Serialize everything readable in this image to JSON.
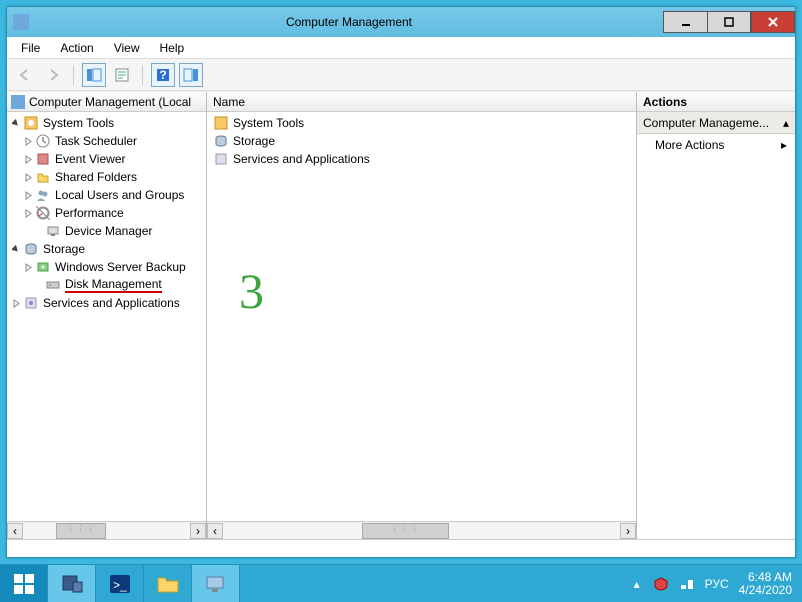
{
  "window": {
    "title": "Computer Management"
  },
  "menubar": [
    "File",
    "Action",
    "View",
    "Help"
  ],
  "tree": {
    "root": "Computer Management (Local",
    "system_tools": {
      "label": "System Tools",
      "children": [
        "Task Scheduler",
        "Event Viewer",
        "Shared Folders",
        "Local Users and Groups",
        "Performance",
        "Device Manager"
      ]
    },
    "storage": {
      "label": "Storage",
      "children": [
        "Windows Server Backup",
        "Disk Management"
      ]
    },
    "services": {
      "label": "Services and Applications"
    }
  },
  "list": {
    "header": "Name",
    "items": [
      "System Tools",
      "Storage",
      "Services and Applications"
    ]
  },
  "actions": {
    "title": "Actions",
    "section": "Computer Manageme...",
    "items": [
      "More Actions"
    ]
  },
  "annotation": {
    "number": "3"
  },
  "taskbar": {
    "lang": "РУС",
    "time": "6:48 AM",
    "date": "4/24/2020"
  }
}
